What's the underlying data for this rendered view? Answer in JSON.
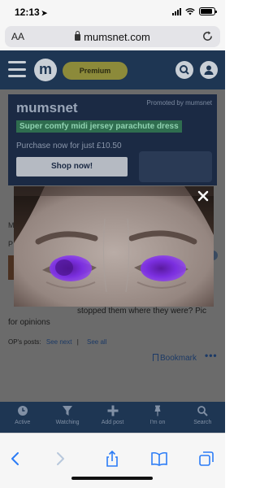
{
  "status_bar": {
    "time": "12:13",
    "location_glyph": "➤"
  },
  "browser": {
    "text_size_label": "AA",
    "url": "mumsnet.com"
  },
  "site_header": {
    "logo_letter": "m",
    "premium_label": "Premium"
  },
  "ad": {
    "promoted_label": "Promoted by mumsnet",
    "brand": "mumsnet",
    "headline": "Super comfy midi jersey parachute dress",
    "price_text": "Purchase now for just £10.50",
    "cta_label": "Shop now!"
  },
  "thread": {
    "fragment_m": "M",
    "fragment_p": "P",
    "fragment_right": "o",
    "body_line1": "stopped them where they were? Pic",
    "body_line2": "for opinions",
    "ops_label": "OP's posts:",
    "see_next": "See next",
    "separator": "|",
    "see_all": "See all",
    "bookmark_label": "Bookmark",
    "more_label": "•••"
  },
  "app_nav": [
    {
      "label": "Active",
      "icon": "clock-icon"
    },
    {
      "label": "Watching",
      "icon": "filter-icon"
    },
    {
      "label": "Add post",
      "icon": "plus-icon"
    },
    {
      "label": "I'm on",
      "icon": "pin-icon"
    },
    {
      "label": "Search",
      "icon": "search-icon"
    }
  ],
  "modal": {
    "image_subject": "close-up photo of eyes with purple highlighter marks over the pupils"
  },
  "colors": {
    "site_navy": "#1e3653",
    "premium_yellow": "#f2ea5a",
    "highlight_purple": "#7b2fe0",
    "ad_green": "#3fc58a"
  }
}
